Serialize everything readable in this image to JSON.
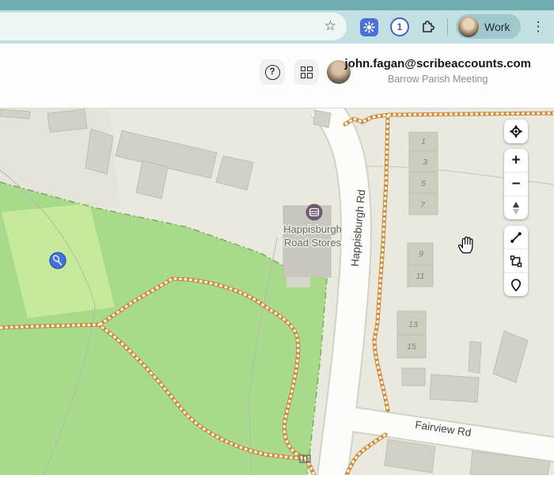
{
  "browser": {
    "profile_label": "Work",
    "password_icon_text": "1",
    "star_icon": "☆",
    "kebab_icon": "⋮"
  },
  "header": {
    "help_icon": "?",
    "email": "john.fagan@scribeaccounts.com",
    "org_name": "Barrow Parish Meeting"
  },
  "map": {
    "store_label_line1": "Happisburgh",
    "store_label_line2": "Road Stores",
    "road_vertical_label": "Happisburgh Rd",
    "road_horizontal_label": "Fairview Rd",
    "house_numbers": [
      "1",
      "3",
      "5",
      "7",
      "9",
      "11",
      "13",
      "15"
    ],
    "controls": {
      "zoom_in": "+",
      "zoom_out": "−"
    },
    "colors": {
      "grass": "#a8da8c",
      "pitch": "#c6e99b",
      "ground": "#eae9df",
      "road": "#fcfcf9",
      "path": "#d08a35",
      "marker": "#4273d9",
      "toolbar_teal": "#c2dfe1"
    }
  }
}
